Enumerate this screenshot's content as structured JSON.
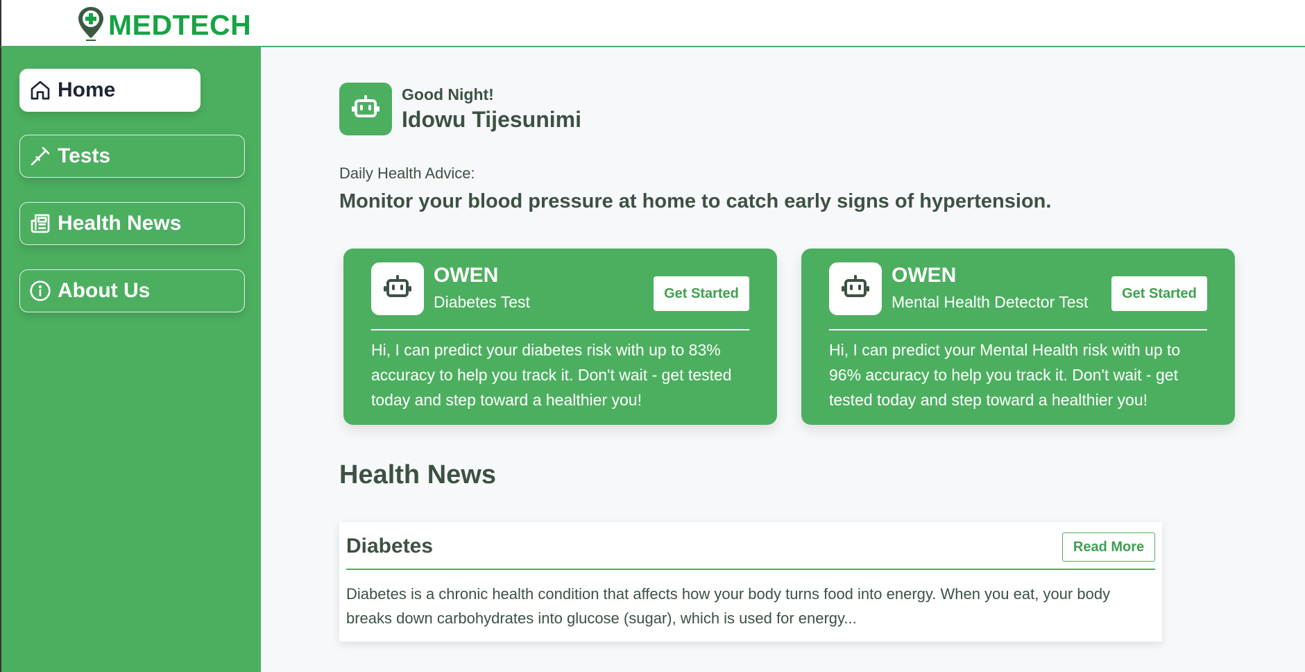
{
  "header": {
    "logo_text": "MEDTECH"
  },
  "sidebar": {
    "items": [
      {
        "label": "Home",
        "icon": "home-icon",
        "active": true
      },
      {
        "label": "Tests",
        "icon": "test-tube-icon",
        "active": false
      },
      {
        "label": "Health News",
        "icon": "newspaper-icon",
        "active": false
      },
      {
        "label": "About Us",
        "icon": "info-icon",
        "active": false
      }
    ]
  },
  "greeting": {
    "salutation": "Good Night!",
    "name": "Idowu Tijesunimi"
  },
  "advice": {
    "label": "Daily Health Advice:",
    "text": "Monitor your blood pressure at home to catch early signs of hypertension."
  },
  "cards": [
    {
      "title": "OWEN",
      "subtitle": "Diabetes Test",
      "button": "Get Started",
      "body": "Hi, I can predict your diabetes risk with up to 83% accuracy to help you track it. Don't wait - get tested today and step toward a healthier you!"
    },
    {
      "title": "OWEN",
      "subtitle": "Mental Health Detector Test",
      "button": "Get Started",
      "body": "Hi, I can predict your Mental Health risk with up to 96% accuracy to help you track it. Don't wait - get tested today and step toward a healthier you!"
    }
  ],
  "news": {
    "heading": "Health News",
    "items": [
      {
        "title": "Diabetes",
        "button": "Read More",
        "body": "Diabetes is a chronic health condition that affects how your body turns food into energy. When you eat, your body breaks down carbohydrates into glucose (sugar), which is used for energy..."
      }
    ]
  },
  "colors": {
    "brand": "#16a344",
    "sidebar": "#4caf60",
    "text": "#3d5143"
  }
}
